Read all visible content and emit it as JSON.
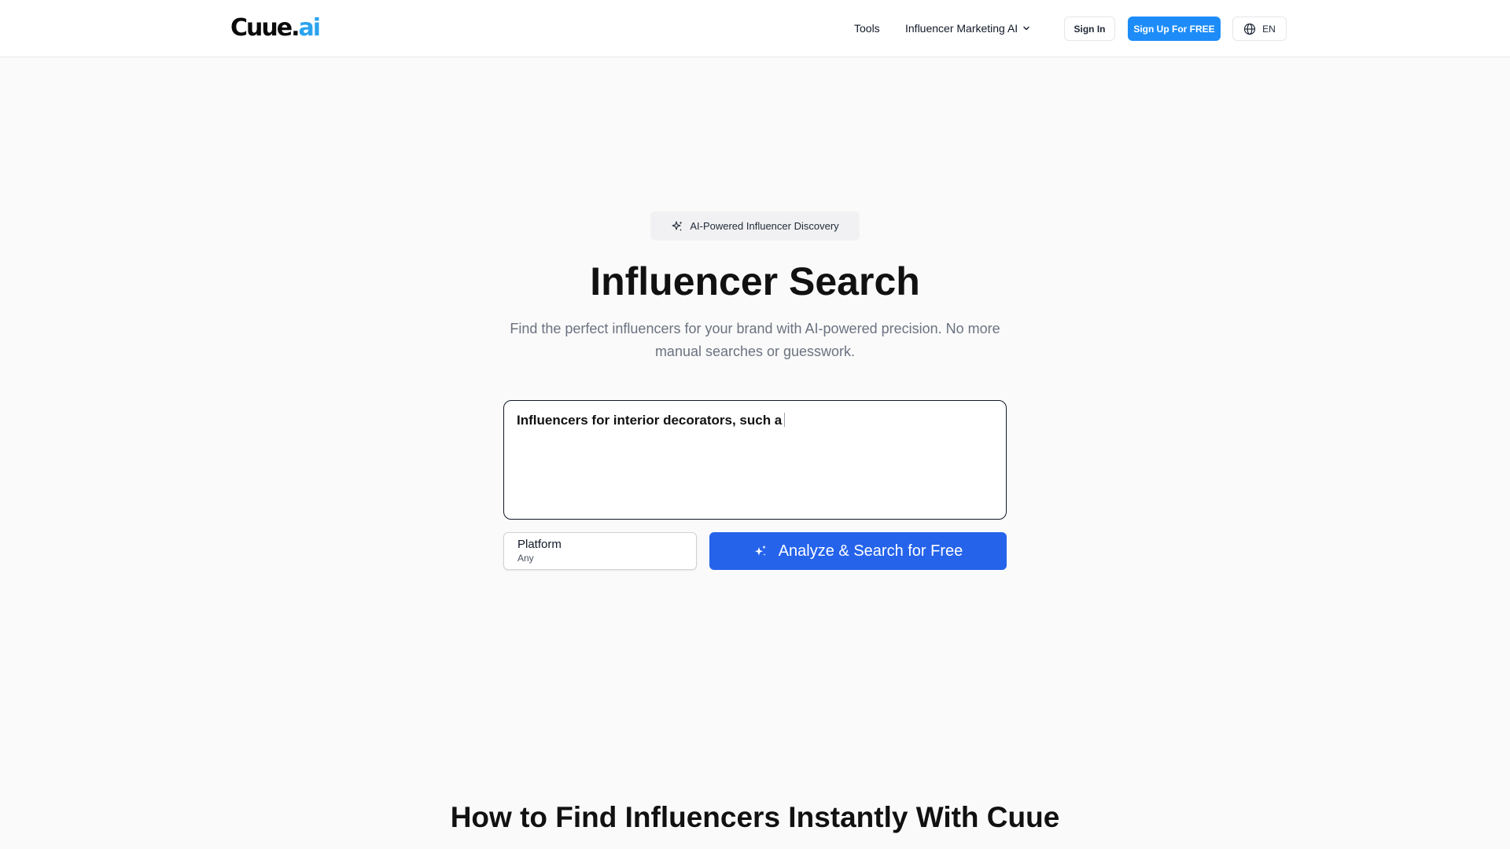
{
  "header": {
    "logo_main": "Cuue.",
    "logo_accent": "ai",
    "nav_tools": "Tools",
    "nav_influencer_ai": "Influencer Marketing AI",
    "sign_in": "Sign In",
    "sign_up": "Sign Up For FREE",
    "language": "EN"
  },
  "hero": {
    "badge": "AI-Powered Influencer Discovery",
    "title": "Influencer Search",
    "subtitle": "Find the perfect influencers for your brand with AI-powered precision. No more manual searches or guesswork."
  },
  "search": {
    "value": "Influencers for interior decorators, such a"
  },
  "platform": {
    "label": "Platform",
    "value": "Any"
  },
  "analyze_button": "Analyze & Search for Free",
  "section": {
    "title": "How to Find Influencers Instantly With Cuue"
  },
  "colors": {
    "accent_blue": "#2563eb",
    "signup_blue": "#1d8cf8",
    "logo_accent": "#2aa3ee"
  },
  "icons": [
    "chevron-down-icon",
    "globe-icon",
    "sparkles-icon"
  ]
}
